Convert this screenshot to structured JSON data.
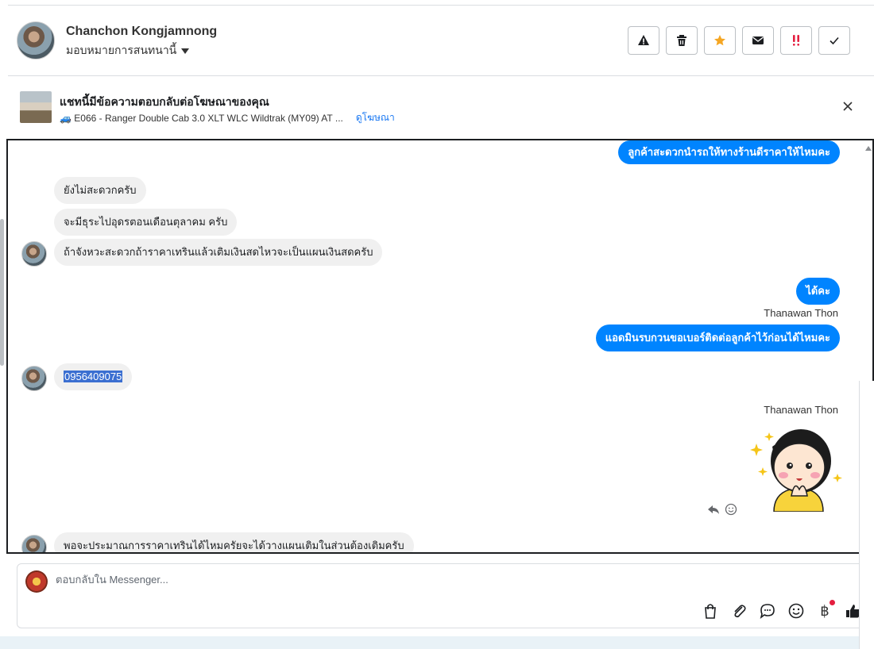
{
  "header": {
    "contact_name": "Chanchon Kongjamnong",
    "assign_label": "มอบหมายการสนทนานี้",
    "actions": [
      "warning-icon",
      "trash-icon",
      "star-icon",
      "envelope-icon",
      "urgent-icon",
      "check-icon"
    ]
  },
  "ad": {
    "title": "แชทนี้มีข้อความตอบกลับต่อโฆษณาของคุณ",
    "subtitle": "🚙 E066 - Ranger Double Cab 3.0 XLT WLC Wildtrak (MY09) AT ...",
    "link": "ดูโฆษณา"
  },
  "messages": {
    "m0": "ลูกค้าสะดวกนำรถให้ทางร้านดีราคาให้ไหมคะ",
    "m1": "ยังไม่สะดวกครับ",
    "m2": "จะมีธุระไปอุดรตอนเดือนตุลาคม ครับ",
    "m3": "ถ้าจังหวะสะดวกถ้าราคาเทรินแล้วเติมเงินสดไหวจะเป็นแผนเงินสดครับ",
    "m4": "ได้คะ",
    "sender1": "Thanawan Thon",
    "m5": "แอดมินรบกวนขอเบอร์ติดต่อลูกค้าไว้ก่อนได้ไหมคะ",
    "m6": "0956409075",
    "sender2": "Thanawan Thon",
    "m7": "พอจะประมาณการราคาเทรินได้ไหมครัยจะได้วางแผนเติมในส่วนต้องเติมครับ"
  },
  "composer": {
    "placeholder": "ตอบกลับใน Messenger...",
    "currency_glyph": "฿"
  },
  "colors": {
    "outgoing": "#0084ff",
    "incoming": "#f0f0f0",
    "selection": "#3b6fd1",
    "badge": "#e41e3f"
  }
}
